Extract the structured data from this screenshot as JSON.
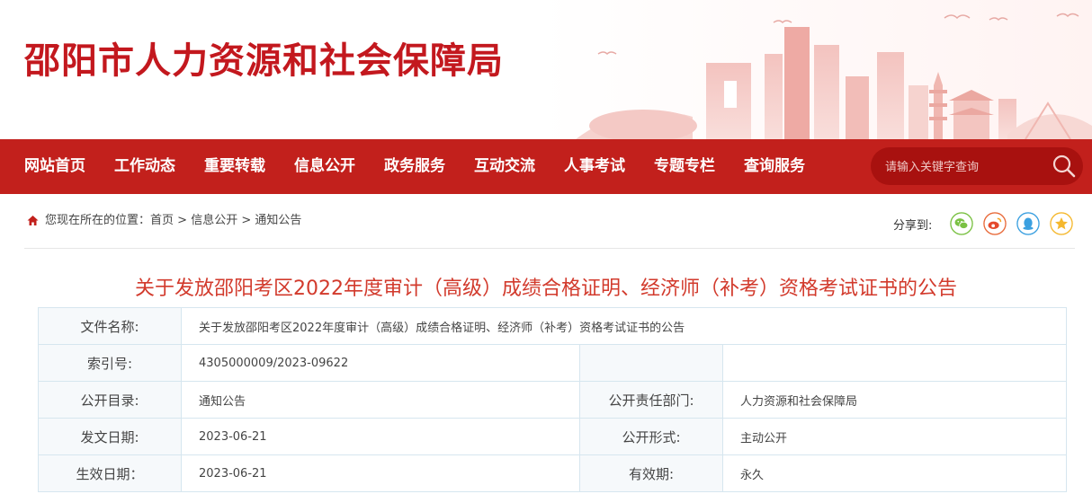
{
  "header": {
    "site_title": "邵阳市人力资源和社会保障局"
  },
  "nav": {
    "items": [
      {
        "label": "网站首页"
      },
      {
        "label": "工作动态"
      },
      {
        "label": "重要转载"
      },
      {
        "label": "信息公开"
      },
      {
        "label": "政务服务"
      },
      {
        "label": "互动交流"
      },
      {
        "label": "人事考试"
      },
      {
        "label": "专题专栏"
      },
      {
        "label": "查询服务"
      }
    ],
    "search_placeholder": "请输入关键字查询"
  },
  "breadcrumb": {
    "prefix": "您现在所在的位置：",
    "items": [
      "首页",
      "信息公开",
      "通知公告"
    ],
    "separator": ">"
  },
  "share": {
    "label": "分享到:",
    "targets": [
      "wechat-icon",
      "weibo-icon",
      "qq-icon",
      "qzone-icon"
    ]
  },
  "article": {
    "title": "关于发放邵阳考区2022年度审计（高级）成绩合格证明、经济师（补考）资格考试证书的公告"
  },
  "meta": {
    "file_name_label": "文件名称:",
    "file_name": "关于发放邵阳考区2022年度审计（高级）成绩合格证明、经济师（补考）资格考试证书的公告",
    "index_label": "索引号:",
    "index": "4305000009/2023-09622",
    "catalog_label": "公开目录:",
    "catalog": "通知公告",
    "dept_label": "公开责任部门:",
    "dept": "人力资源和社会保障局",
    "issue_date_label": "发文日期:",
    "issue_date": "2023-06-21",
    "form_label": "公开形式:",
    "form": "主动公开",
    "effective_label": "生效日期：",
    "effective_date": "2023-06-21",
    "validity_label": "有效期:",
    "validity": "永久"
  },
  "colors": {
    "brand_red": "#c2201c",
    "title_red": "#d23a2c",
    "search_bg": "#a8110f"
  }
}
